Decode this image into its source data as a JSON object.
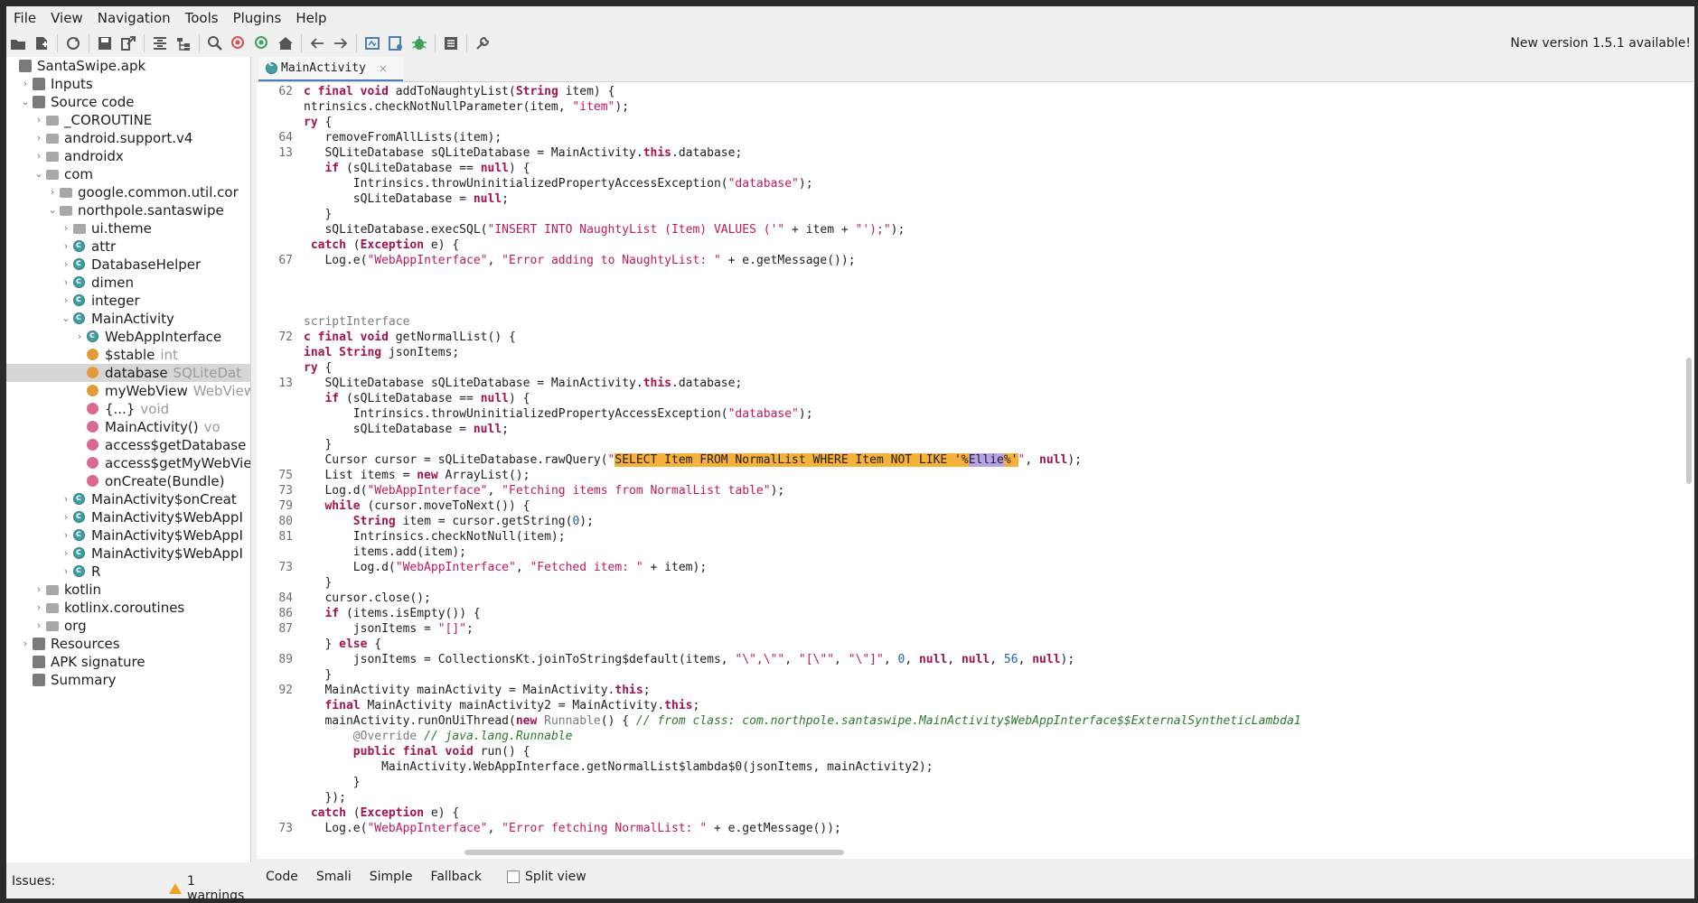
{
  "menubar": [
    "File",
    "View",
    "Navigation",
    "Tools",
    "Plugins",
    "Help"
  ],
  "toolbar": {
    "icons": [
      "open-file-icon",
      "add-file-icon",
      "sync-icon",
      "save-icon",
      "export-icon",
      "flatten-icon",
      "tree-icon",
      "search-icon",
      "find-class-icon",
      "find-usage-icon",
      "home-icon",
      "back-icon",
      "forward-icon",
      "deobf-icon",
      "quark-icon",
      "debug-icon",
      "log-icon",
      "prefs-icon"
    ],
    "new_version": "New version 1.5.1 available!"
  },
  "tree": [
    {
      "label": "SantaSwipe.apk",
      "type": "",
      "indent": 0,
      "icon": "apk",
      "twisty": ""
    },
    {
      "label": "Inputs",
      "type": "",
      "indent": 1,
      "icon": "inputs",
      "twisty": "›"
    },
    {
      "label": "Source code",
      "type": "",
      "indent": 1,
      "icon": "package",
      "twisty": "⌄"
    },
    {
      "label": "_COROUTINE",
      "type": "",
      "indent": 2,
      "icon": "folder",
      "twisty": "›"
    },
    {
      "label": "android.support.v4",
      "type": "",
      "indent": 2,
      "icon": "folder",
      "twisty": "›"
    },
    {
      "label": "androidx",
      "type": "",
      "indent": 2,
      "icon": "folder",
      "twisty": "›"
    },
    {
      "label": "com",
      "type": "",
      "indent": 2,
      "icon": "folder",
      "twisty": "⌄"
    },
    {
      "label": "google.common.util.cor",
      "type": "",
      "indent": 3,
      "icon": "folder",
      "twisty": "›"
    },
    {
      "label": "northpole.santaswipe",
      "type": "",
      "indent": 3,
      "icon": "folder",
      "twisty": "⌄"
    },
    {
      "label": "ui.theme",
      "type": "",
      "indent": 4,
      "icon": "folder",
      "twisty": "›"
    },
    {
      "label": "attr",
      "type": "",
      "indent": 4,
      "icon": "class",
      "twisty": "›"
    },
    {
      "label": "DatabaseHelper",
      "type": "",
      "indent": 4,
      "icon": "class",
      "twisty": "›"
    },
    {
      "label": "dimen",
      "type": "",
      "indent": 4,
      "icon": "class",
      "twisty": "›"
    },
    {
      "label": "integer",
      "type": "",
      "indent": 4,
      "icon": "class",
      "twisty": "›"
    },
    {
      "label": "MainActivity",
      "type": "",
      "indent": 4,
      "icon": "class",
      "twisty": "⌄"
    },
    {
      "label": "WebAppInterface",
      "type": "",
      "indent": 5,
      "icon": "class",
      "twisty": "›"
    },
    {
      "label": "$stable",
      "type": "int",
      "indent": 5,
      "icon": "field",
      "twisty": ""
    },
    {
      "label": "database",
      "type": "SQLiteDat",
      "indent": 5,
      "icon": "field",
      "twisty": "",
      "selected": true
    },
    {
      "label": "myWebView",
      "type": "WebView",
      "indent": 5,
      "icon": "field",
      "twisty": ""
    },
    {
      "label": "{...}",
      "type": "void",
      "indent": 5,
      "icon": "method",
      "twisty": ""
    },
    {
      "label": "MainActivity()",
      "type": "vo",
      "indent": 5,
      "icon": "method",
      "twisty": ""
    },
    {
      "label": "access$getDatabase",
      "type": "",
      "indent": 5,
      "icon": "method",
      "twisty": ""
    },
    {
      "label": "access$getMyWebVie",
      "type": "",
      "indent": 5,
      "icon": "method",
      "twisty": ""
    },
    {
      "label": "onCreate(Bundle)",
      "type": "",
      "indent": 5,
      "icon": "method",
      "twisty": ""
    },
    {
      "label": "MainActivity$onCreat",
      "type": "",
      "indent": 4,
      "icon": "class",
      "twisty": "›"
    },
    {
      "label": "MainActivity$WebAppI",
      "type": "",
      "indent": 4,
      "icon": "class",
      "twisty": "›"
    },
    {
      "label": "MainActivity$WebAppI",
      "type": "",
      "indent": 4,
      "icon": "class",
      "twisty": "›"
    },
    {
      "label": "MainActivity$WebAppI",
      "type": "",
      "indent": 4,
      "icon": "class",
      "twisty": "›"
    },
    {
      "label": "R",
      "type": "",
      "indent": 4,
      "icon": "class",
      "twisty": "›"
    },
    {
      "label": "kotlin",
      "type": "",
      "indent": 2,
      "icon": "folder",
      "twisty": "›"
    },
    {
      "label": "kotlinx.coroutines",
      "type": "",
      "indent": 2,
      "icon": "folder",
      "twisty": "›"
    },
    {
      "label": "org",
      "type": "",
      "indent": 2,
      "icon": "folder",
      "twisty": "›"
    },
    {
      "label": "Resources",
      "type": "",
      "indent": 1,
      "icon": "resources",
      "twisty": "›"
    },
    {
      "label": "APK signature",
      "type": "",
      "indent": 1,
      "icon": "signature",
      "twisty": ""
    },
    {
      "label": "Summary",
      "type": "",
      "indent": 1,
      "icon": "summary",
      "twisty": ""
    }
  ],
  "editor_tab": {
    "label": "MainActivity",
    "close": "×"
  },
  "code": [
    {
      "ln": "62",
      "segs": [
        [
          "kw",
          "c final void "
        ],
        [
          "",
          "addToNaughtyList("
        ],
        [
          "kw",
          "String"
        ],
        [
          "",
          " item) {"
        ]
      ]
    },
    {
      "ln": "",
      "segs": [
        [
          "",
          "ntrinsics.checkNotNullParameter(item, "
        ],
        [
          "str",
          "\"item\""
        ],
        [
          "",
          ");"
        ]
      ]
    },
    {
      "ln": "",
      "segs": [
        [
          "kw",
          "ry"
        ],
        [
          "",
          " {"
        ]
      ]
    },
    {
      "ln": "64",
      "segs": [
        [
          "",
          "   removeFromAllLists(item);"
        ]
      ]
    },
    {
      "ln": "13",
      "segs": [
        [
          "",
          "   SQLiteDatabase sQLiteDatabase = MainActivity."
        ],
        [
          "kw",
          "this"
        ],
        [
          "",
          ".database;"
        ]
      ]
    },
    {
      "ln": "",
      "segs": [
        [
          "",
          "   "
        ],
        [
          "kw",
          "if"
        ],
        [
          "",
          " (sQLiteDatabase == "
        ],
        [
          "kw",
          "null"
        ],
        [
          "",
          ") {"
        ]
      ]
    },
    {
      "ln": "",
      "segs": [
        [
          "",
          "       Intrinsics.throwUninitializedPropertyAccessException("
        ],
        [
          "str",
          "\"database\""
        ],
        [
          "",
          ");"
        ]
      ]
    },
    {
      "ln": "",
      "segs": [
        [
          "",
          "       sQLiteDatabase = "
        ],
        [
          "kw",
          "null"
        ],
        [
          "",
          ";"
        ]
      ]
    },
    {
      "ln": "",
      "segs": [
        [
          "",
          "   }"
        ]
      ]
    },
    {
      "ln": "",
      "segs": [
        [
          "",
          "   sQLiteDatabase.execSQL("
        ],
        [
          "str",
          "\"INSERT INTO NaughtyList (Item) VALUES ('\""
        ],
        [
          "",
          " + item + "
        ],
        [
          "str",
          "\"');\""
        ],
        [
          "",
          ");"
        ]
      ]
    },
    {
      "ln": "",
      "segs": [
        [
          "",
          " "
        ],
        [
          "kw",
          "catch"
        ],
        [
          "",
          " ("
        ],
        [
          "kw",
          "Exception"
        ],
        [
          "",
          " e) {"
        ]
      ]
    },
    {
      "ln": "67",
      "segs": [
        [
          "",
          "   Log.e("
        ],
        [
          "str",
          "\"WebAppInterface\""
        ],
        [
          "",
          ", "
        ],
        [
          "str",
          "\"Error adding to NaughtyList: \""
        ],
        [
          "",
          " + e.getMessage());"
        ]
      ]
    },
    {
      "ln": "",
      "segs": []
    },
    {
      "ln": "",
      "segs": []
    },
    {
      "ln": "",
      "segs": []
    },
    {
      "ln": "",
      "segs": [
        [
          "ann",
          "scriptInterface"
        ]
      ]
    },
    {
      "ln": "72",
      "segs": [
        [
          "kw",
          "c final void "
        ],
        [
          "",
          "getNormalList() {"
        ]
      ]
    },
    {
      "ln": "",
      "segs": [
        [
          "kw",
          "inal String"
        ],
        [
          "",
          " jsonItems;"
        ]
      ]
    },
    {
      "ln": "",
      "segs": [
        [
          "kw",
          "ry"
        ],
        [
          "",
          " {"
        ]
      ]
    },
    {
      "ln": "13",
      "segs": [
        [
          "",
          "   SQLiteDatabase sQLiteDatabase = MainActivity."
        ],
        [
          "kw",
          "this"
        ],
        [
          "",
          ".database;"
        ]
      ]
    },
    {
      "ln": "",
      "segs": [
        [
          "",
          "   "
        ],
        [
          "kw",
          "if"
        ],
        [
          "",
          " (sQLiteDatabase == "
        ],
        [
          "kw",
          "null"
        ],
        [
          "",
          ") {"
        ]
      ]
    },
    {
      "ln": "",
      "segs": [
        [
          "",
          "       Intrinsics.throwUninitializedPropertyAccessException("
        ],
        [
          "str",
          "\"database\""
        ],
        [
          "",
          ");"
        ]
      ]
    },
    {
      "ln": "",
      "segs": [
        [
          "",
          "       sQLiteDatabase = "
        ],
        [
          "kw",
          "null"
        ],
        [
          "",
          ";"
        ]
      ]
    },
    {
      "ln": "",
      "segs": [
        [
          "",
          "   }"
        ]
      ]
    },
    {
      "ln": "",
      "segs": [
        [
          "",
          "   Cursor cursor = sQLiteDatabase.rawQuery("
        ],
        [
          "str",
          "\""
        ],
        [
          "hl",
          "SELECT Item FROM NormalList WHERE Item NOT LIKE '%"
        ],
        [
          "hl2",
          "Ellie"
        ],
        [
          "hl",
          "%'"
        ],
        [
          "str",
          "\""
        ],
        [
          "",
          ", "
        ],
        [
          "kw",
          "null"
        ],
        [
          "",
          ");"
        ]
      ]
    },
    {
      "ln": "75",
      "segs": [
        [
          "",
          "   List items = "
        ],
        [
          "kw",
          "new"
        ],
        [
          "",
          " ArrayList();"
        ]
      ]
    },
    {
      "ln": "73",
      "segs": [
        [
          "",
          "   Log.d("
        ],
        [
          "str",
          "\"WebAppInterface\""
        ],
        [
          "",
          ", "
        ],
        [
          "str",
          "\"Fetching items from NormalList table\""
        ],
        [
          "",
          ");"
        ]
      ]
    },
    {
      "ln": "79",
      "segs": [
        [
          "",
          "   "
        ],
        [
          "kw",
          "while"
        ],
        [
          "",
          " (cursor.moveToNext()) {"
        ]
      ]
    },
    {
      "ln": "80",
      "segs": [
        [
          "",
          "       "
        ],
        [
          "kw",
          "String"
        ],
        [
          "",
          " item = cursor.getString("
        ],
        [
          "num",
          "0"
        ],
        [
          "",
          ");"
        ]
      ]
    },
    {
      "ln": "81",
      "segs": [
        [
          "",
          "       Intrinsics.checkNotNull(item);"
        ]
      ]
    },
    {
      "ln": "",
      "segs": [
        [
          "",
          "       items.add(item);"
        ]
      ]
    },
    {
      "ln": "73",
      "segs": [
        [
          "",
          "       Log.d("
        ],
        [
          "str",
          "\"WebAppInterface\""
        ],
        [
          "",
          ", "
        ],
        [
          "str",
          "\"Fetched item: \""
        ],
        [
          "",
          " + item);"
        ]
      ]
    },
    {
      "ln": "",
      "segs": [
        [
          "",
          "   }"
        ]
      ]
    },
    {
      "ln": "84",
      "segs": [
        [
          "",
          "   cursor.close();"
        ]
      ]
    },
    {
      "ln": "86",
      "segs": [
        [
          "",
          "   "
        ],
        [
          "kw",
          "if"
        ],
        [
          "",
          " (items.isEmpty()) {"
        ]
      ]
    },
    {
      "ln": "87",
      "segs": [
        [
          "",
          "       jsonItems = "
        ],
        [
          "str",
          "\"[]\""
        ],
        [
          "",
          ";"
        ]
      ]
    },
    {
      "ln": "",
      "segs": [
        [
          "",
          "   } "
        ],
        [
          "kw",
          "else"
        ],
        [
          "",
          " {"
        ]
      ]
    },
    {
      "ln": "89",
      "segs": [
        [
          "",
          "       jsonItems = CollectionsKt.joinToString$default(items, "
        ],
        [
          "str",
          "\"\\\",\\\"\""
        ],
        [
          "",
          ", "
        ],
        [
          "str",
          "\"[\\\"\""
        ],
        [
          "",
          ", "
        ],
        [
          "str",
          "\"\\\"]\""
        ],
        [
          "",
          ", "
        ],
        [
          "num",
          "0"
        ],
        [
          "",
          ", "
        ],
        [
          "kw",
          "null"
        ],
        [
          "",
          ", "
        ],
        [
          "kw",
          "null"
        ],
        [
          "",
          ", "
        ],
        [
          "num",
          "56"
        ],
        [
          "",
          ", "
        ],
        [
          "kw",
          "null"
        ],
        [
          "",
          ");"
        ]
      ]
    },
    {
      "ln": "",
      "segs": [
        [
          "",
          "   }"
        ]
      ]
    },
    {
      "ln": "92",
      "segs": [
        [
          "",
          "   MainActivity mainActivity = MainActivity."
        ],
        [
          "kw",
          "this"
        ],
        [
          "",
          ";"
        ]
      ]
    },
    {
      "ln": "",
      "segs": [
        [
          "",
          "   "
        ],
        [
          "kw",
          "final"
        ],
        [
          "",
          " MainActivity mainActivity2 = MainActivity."
        ],
        [
          "kw",
          "this"
        ],
        [
          "",
          ";"
        ]
      ]
    },
    {
      "ln": "",
      "segs": [
        [
          "",
          "   mainActivity.runOnUiThread("
        ],
        [
          "kw",
          "new"
        ],
        [
          "",
          " "
        ],
        [
          "ann",
          "Runnable"
        ],
        [
          "",
          "() { "
        ],
        [
          "cm",
          "// from class: com.northpole.santaswipe.MainActivity$WebAppInterface$$ExternalSyntheticLambda1"
        ]
      ]
    },
    {
      "ln": "",
      "segs": [
        [
          "",
          "       "
        ],
        [
          "ann",
          "@Override"
        ],
        [
          "",
          " "
        ],
        [
          "cm",
          "// java.lang.Runnable"
        ]
      ]
    },
    {
      "ln": "",
      "segs": [
        [
          "",
          "       "
        ],
        [
          "kw",
          "public final void"
        ],
        [
          "",
          " run() {"
        ]
      ]
    },
    {
      "ln": "",
      "segs": [
        [
          "",
          "           MainActivity.WebAppInterface.getNormalList$lambda$0(jsonItems, mainActivity2);"
        ]
      ]
    },
    {
      "ln": "",
      "segs": [
        [
          "",
          "       }"
        ]
      ]
    },
    {
      "ln": "",
      "segs": [
        [
          "",
          "   });"
        ]
      ]
    },
    {
      "ln": "",
      "segs": [
        [
          "",
          " "
        ],
        [
          "kw",
          "catch"
        ],
        [
          "",
          " ("
        ],
        [
          "kw",
          "Exception"
        ],
        [
          "",
          " e) {"
        ]
      ]
    },
    {
      "ln": "73",
      "segs": [
        [
          "",
          "   Log.e("
        ],
        [
          "str",
          "\"WebAppInterface\""
        ],
        [
          "",
          ", "
        ],
        [
          "str",
          "\"Error fetching NormalList: \""
        ],
        [
          "",
          " + e.getMessage());"
        ]
      ]
    }
  ],
  "bottom_tabs": [
    "Code",
    "Smali",
    "Simple",
    "Fallback"
  ],
  "split_view": "Split view",
  "issues": {
    "label": "Issues:",
    "warnings": "1 warnings"
  }
}
